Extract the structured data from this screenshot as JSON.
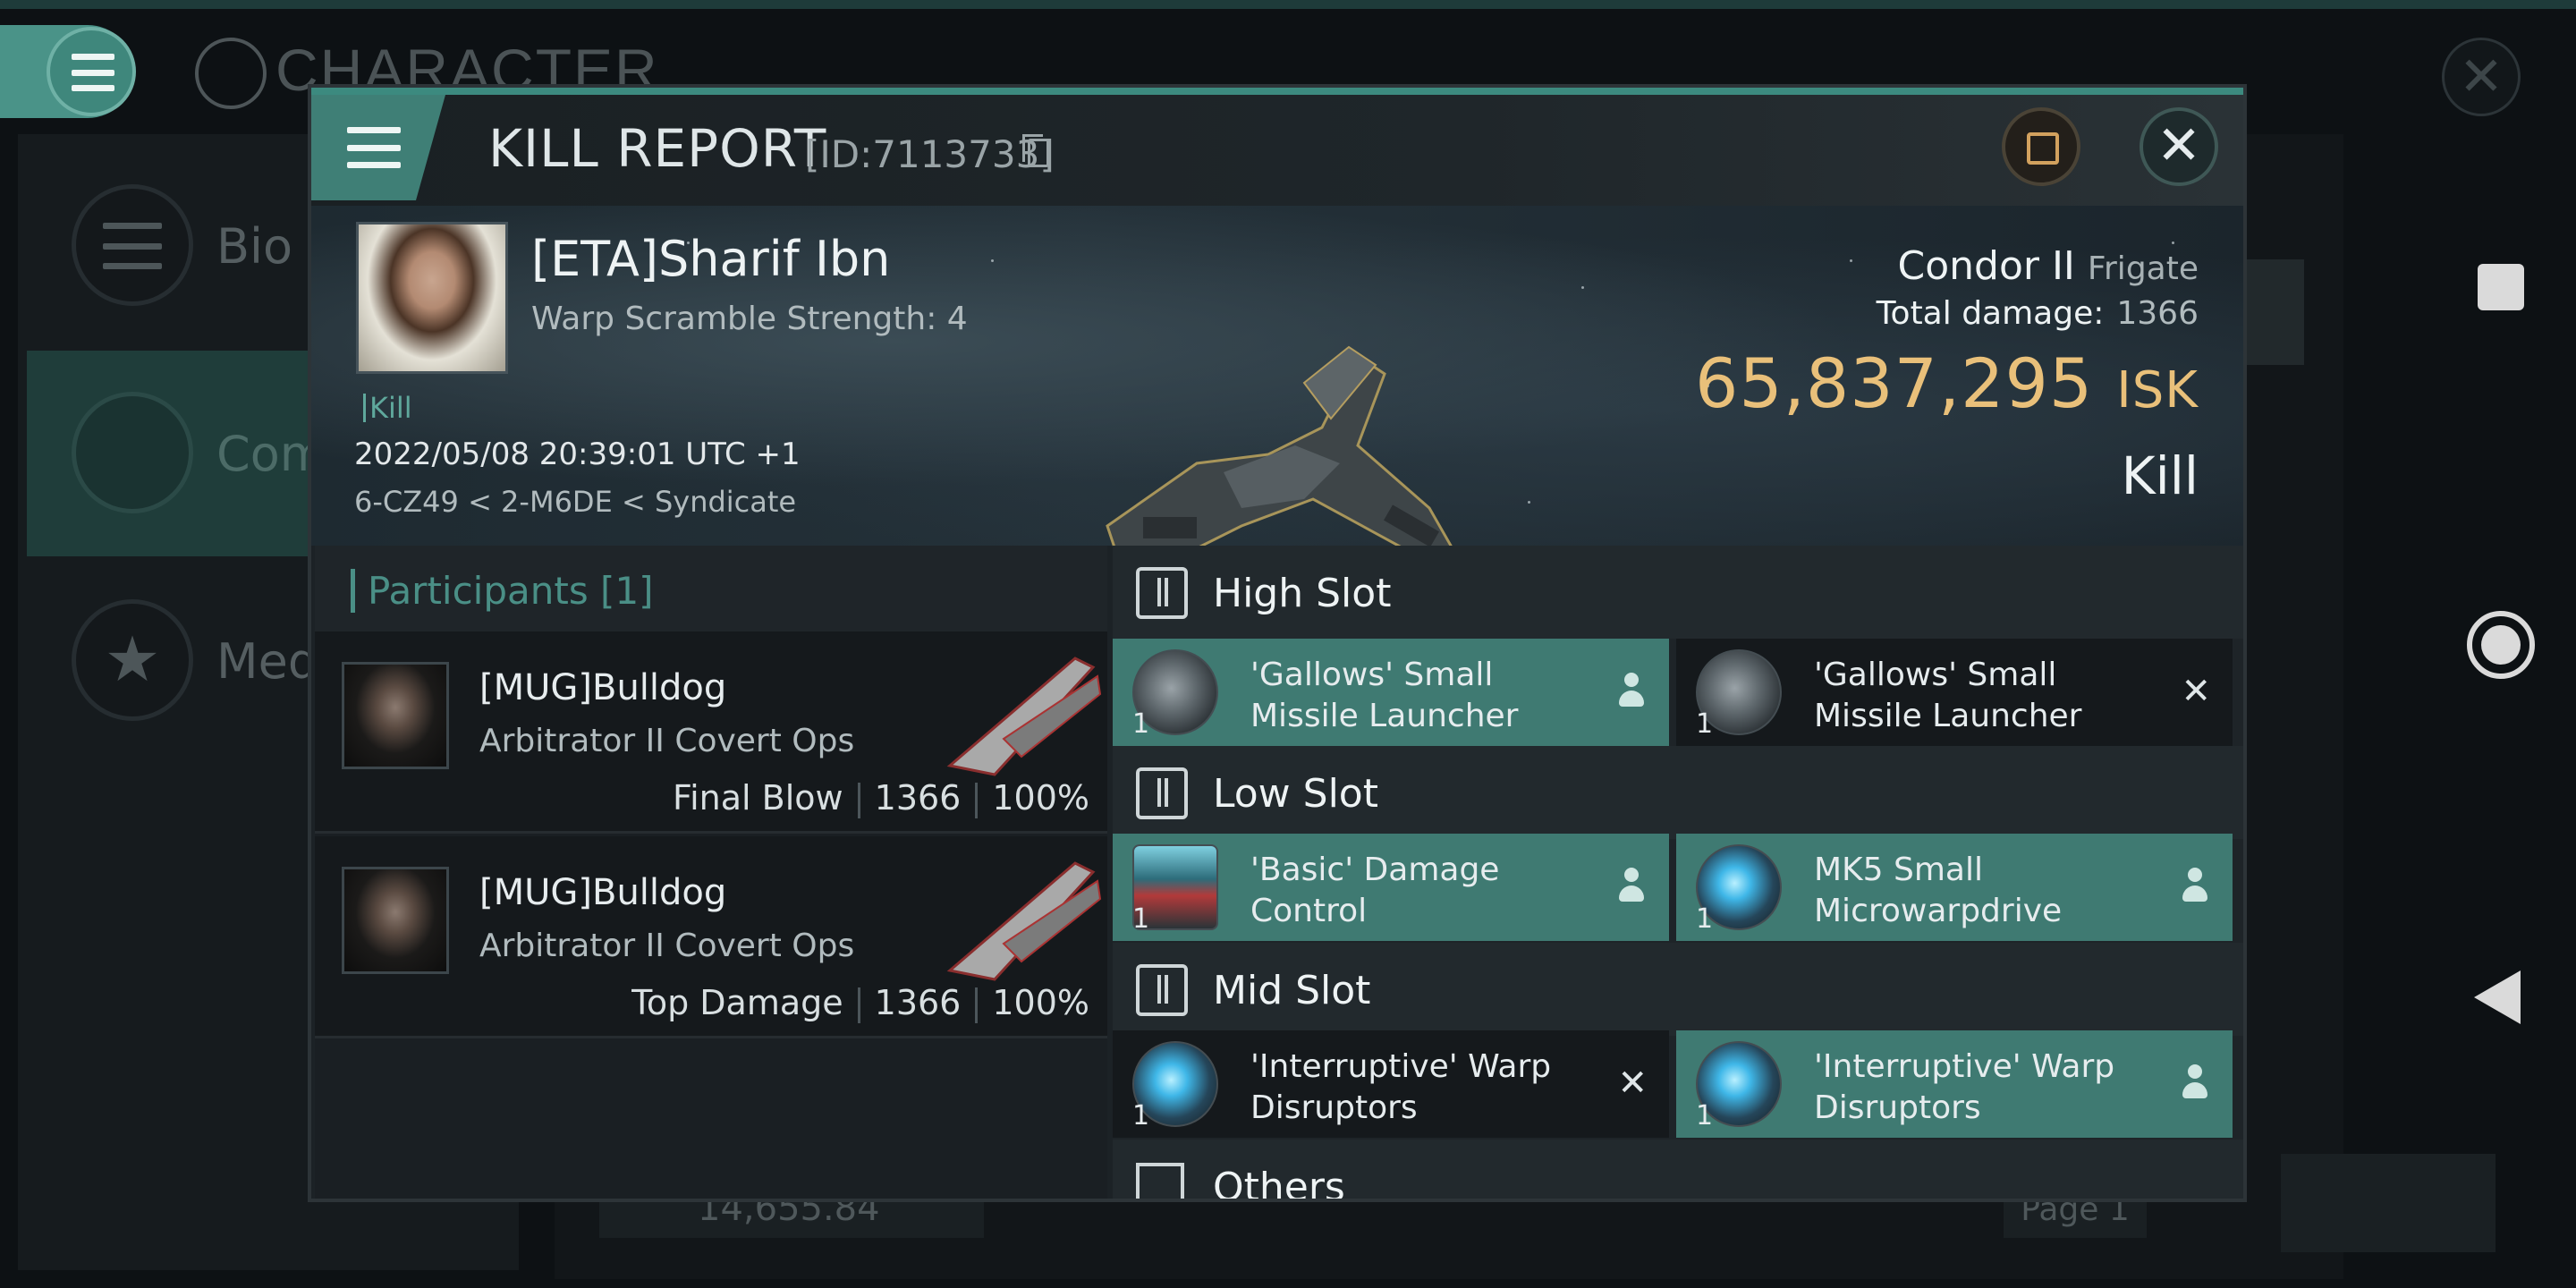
{
  "background": {
    "title": "CHARACTER",
    "sidebar": [
      {
        "label": "Bio",
        "icon": "hamburger-icon"
      },
      {
        "label": "Com",
        "icon": "crossed-swords-icon",
        "selected": true
      },
      {
        "label": "Med",
        "icon": "star-badge-icon"
      }
    ],
    "wallet_amount": "14,655.84",
    "page_label": "Page 1"
  },
  "modal": {
    "title": "KILL REPORT",
    "id_label": "[ID:7113733]",
    "victim": {
      "name": "[ETA]Sharif Ibn",
      "scram": "Warp Scramble Strength: 4",
      "tag": "Kill",
      "date": "2022/05/08 20:39:01 UTC +1",
      "location": "6-CZ49 < 2-M6DE < Syndicate"
    },
    "ship": {
      "name": "Condor II",
      "class": "Frigate",
      "damage_label": "Total damage:",
      "damage_value": "1366",
      "isk_value": "65,837,295",
      "isk_unit": "ISK",
      "result": "Kill"
    },
    "participants": {
      "header": "Participants [1]",
      "rows": [
        {
          "name": "[MUG]Bulldog",
          "ship": "Arbitrator II Covert Ops",
          "role": "Final Blow",
          "damage": "1366",
          "percent": "100%"
        },
        {
          "name": "[MUG]Bulldog",
          "ship": "Arbitrator II Covert Ops",
          "role": "Top Damage",
          "damage": "1366",
          "percent": "100%"
        }
      ]
    },
    "slots": {
      "high": {
        "label": "High Slot",
        "modules": [
          {
            "qty": "1",
            "name1": "'Gallows' Small",
            "name2": "Missile Launcher",
            "status": "fitted"
          },
          {
            "qty": "1",
            "name1": "'Gallows' Small",
            "name2": "Missile Launcher",
            "status": "destroyed"
          }
        ]
      },
      "low": {
        "label": "Low Slot",
        "modules": [
          {
            "qty": "1",
            "name1": "'Basic' Damage",
            "name2": "Control",
            "status": "fitted"
          },
          {
            "qty": "1",
            "name1": "MK5 Small",
            "name2": "Microwarpdrive",
            "status": "fitted"
          }
        ]
      },
      "mid": {
        "label": "Mid Slot",
        "modules": [
          {
            "qty": "1",
            "name1": "'Interruptive' Warp",
            "name2": "Disruptors",
            "status": "destroyed"
          },
          {
            "qty": "1",
            "name1": "'Interruptive' Warp",
            "name2": "Disruptors",
            "status": "fitted"
          }
        ]
      },
      "others": {
        "label": "Others"
      }
    },
    "close_glyph": "✕",
    "destroyed_glyph": "✕"
  }
}
